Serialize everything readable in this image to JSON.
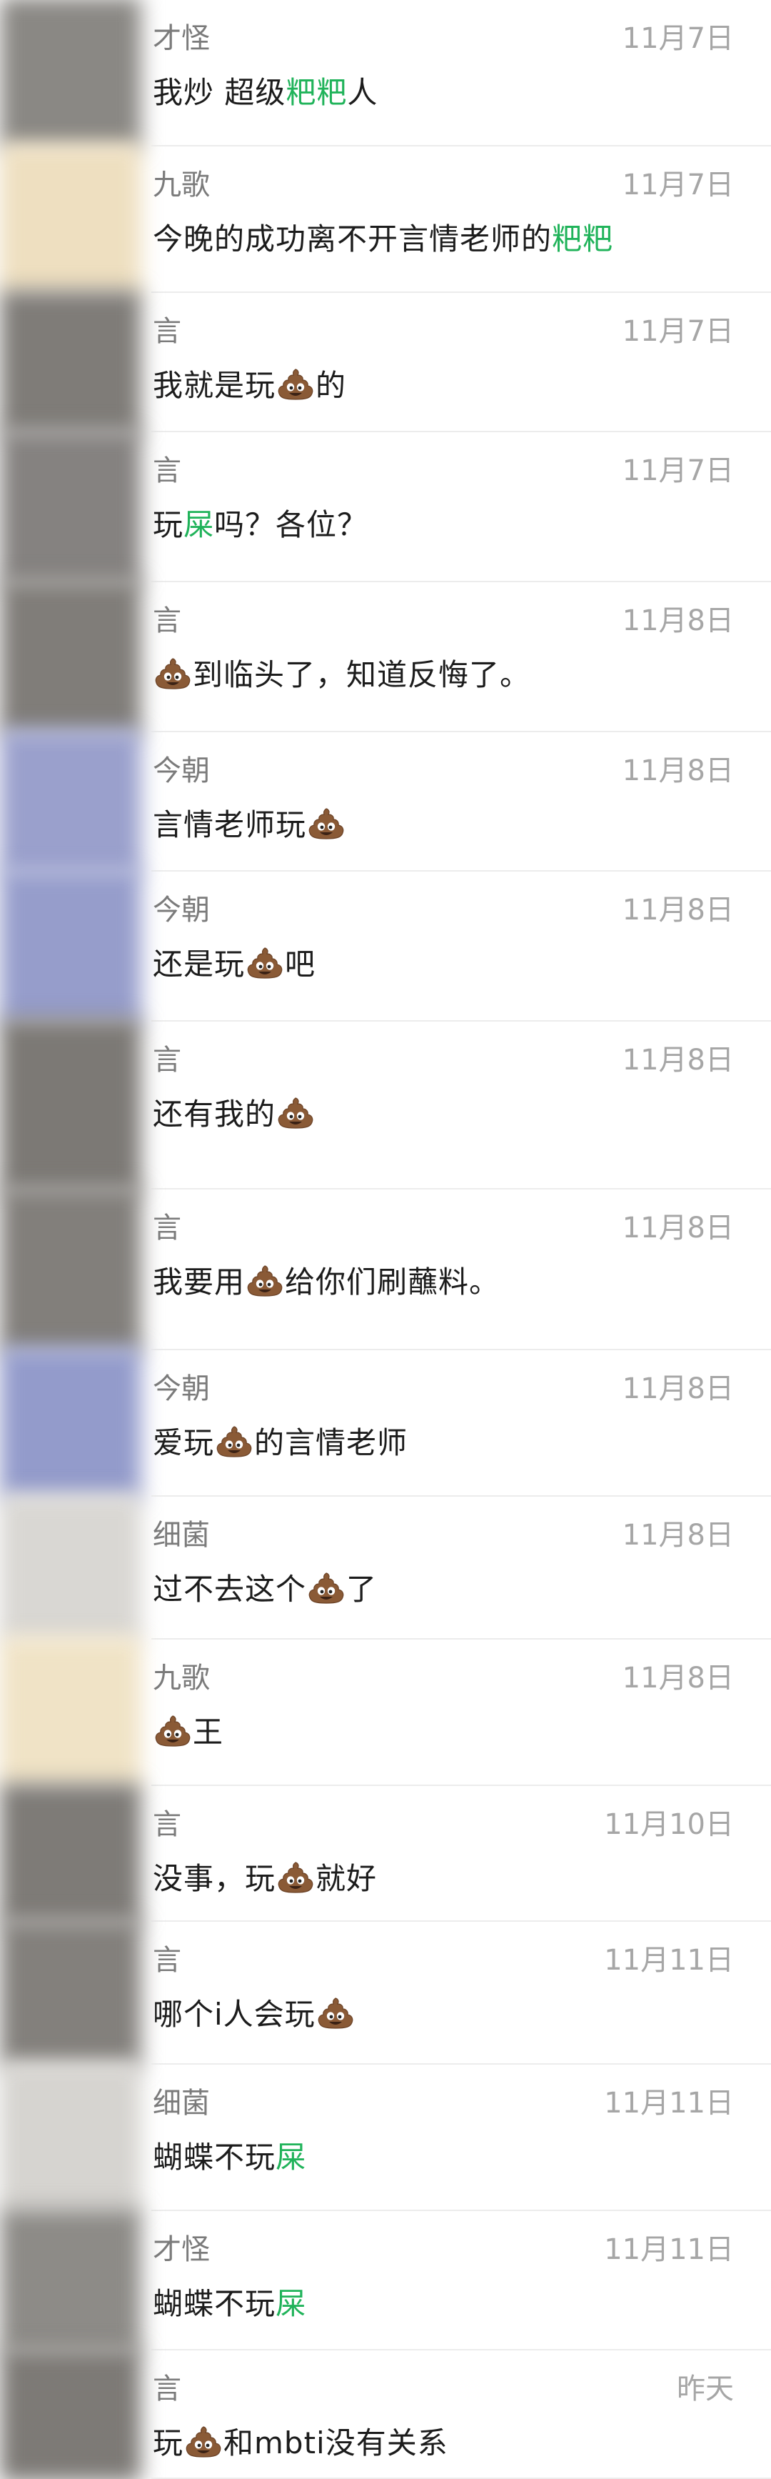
{
  "colors": {
    "highlight": "#20b35a",
    "sender": "#7b7b7b",
    "date": "#a6a6a6",
    "text": "#1c1c1c",
    "avatar_palette": [
      "#8c8a86",
      "#e9d9b6",
      "#9097c6",
      "#d7d5d1",
      "#7f7b77"
    ]
  },
  "messages": [
    {
      "sender": "才怪",
      "date": "11月7日",
      "avatar": "#8a8884",
      "segments": [
        {
          "t": "text",
          "v": "我炒 超级"
        },
        {
          "t": "hl",
          "v": "粑粑"
        },
        {
          "t": "text",
          "v": "人"
        }
      ]
    },
    {
      "sender": "九歌",
      "date": "11月7日",
      "avatar": "#eedfc0",
      "segments": [
        {
          "t": "text",
          "v": "今晚的成功离不开言情老师的"
        },
        {
          "t": "hl",
          "v": "粑粑"
        }
      ]
    },
    {
      "sender": "言",
      "date": "11月7日",
      "avatar": "#7f7c78",
      "segments": [
        {
          "t": "text",
          "v": "我就是玩"
        },
        {
          "t": "icon",
          "v": "poop-emoji"
        },
        {
          "t": "text",
          "v": "的"
        }
      ]
    },
    {
      "sender": "言",
      "date": "11月7日",
      "avatar": "#858280",
      "segments": [
        {
          "t": "text",
          "v": "玩"
        },
        {
          "t": "hl",
          "v": "屎"
        },
        {
          "t": "text",
          "v": "吗？各位？"
        }
      ]
    },
    {
      "sender": "言",
      "date": "11月8日",
      "avatar": "#807d79",
      "segments": [
        {
          "t": "icon",
          "v": "poop-emoji"
        },
        {
          "t": "text",
          "v": "到临头了，知道反悔了。"
        }
      ]
    },
    {
      "sender": "今朝",
      "date": "11月8日",
      "avatar": "#9aa0cc",
      "segments": [
        {
          "t": "text",
          "v": "言情老师玩"
        },
        {
          "t": "icon",
          "v": "poop-emoji"
        }
      ]
    },
    {
      "sender": "今朝",
      "date": "11月8日",
      "avatar": "#969dcb",
      "segments": [
        {
          "t": "text",
          "v": "还是玩"
        },
        {
          "t": "icon",
          "v": "poop-emoji"
        },
        {
          "t": "text",
          "v": "吧"
        }
      ]
    },
    {
      "sender": "言",
      "date": "11月8日",
      "avatar": "#7c7975",
      "segments": [
        {
          "t": "text",
          "v": "还有我的"
        },
        {
          "t": "icon",
          "v": "poop-emoji"
        }
      ]
    },
    {
      "sender": "言",
      "date": "11月8日",
      "avatar": "#827f7b",
      "segments": [
        {
          "t": "text",
          "v": "我要用"
        },
        {
          "t": "icon",
          "v": "poop-emoji"
        },
        {
          "t": "text",
          "v": "给你们刷蘸料。"
        }
      ]
    },
    {
      "sender": "今朝",
      "date": "11月8日",
      "avatar": "#939bcb",
      "segments": [
        {
          "t": "text",
          "v": "爱玩"
        },
        {
          "t": "icon",
          "v": "poop-emoji"
        },
        {
          "t": "text",
          "v": "的言情老师"
        }
      ]
    },
    {
      "sender": "细菌",
      "date": "11月8日",
      "avatar": "#d9d7d3",
      "segments": [
        {
          "t": "text",
          "v": "过不去这个"
        },
        {
          "t": "icon",
          "v": "poop-emoji"
        },
        {
          "t": "text",
          "v": "了"
        }
      ]
    },
    {
      "sender": "九歌",
      "date": "11月8日",
      "avatar": "#f0e3c6",
      "segments": [
        {
          "t": "icon",
          "v": "poop-emoji"
        },
        {
          "t": "text",
          "v": "王"
        }
      ]
    },
    {
      "sender": "言",
      "date": "11月10日",
      "avatar": "#7e7b77",
      "segments": [
        {
          "t": "text",
          "v": "没事，玩"
        },
        {
          "t": "icon",
          "v": "poop-emoji"
        },
        {
          "t": "text",
          "v": "就好"
        }
      ]
    },
    {
      "sender": "言",
      "date": "11月11日",
      "avatar": "#83807c",
      "segments": [
        {
          "t": "text",
          "v": "哪个i人会玩"
        },
        {
          "t": "icon",
          "v": "poop-emoji"
        }
      ]
    },
    {
      "sender": "细菌",
      "date": "11月11日",
      "avatar": "#d6d4d0",
      "segments": [
        {
          "t": "text",
          "v": "蝴蝶不玩"
        },
        {
          "t": "hl",
          "v": "屎"
        }
      ]
    },
    {
      "sender": "才怪",
      "date": "11月11日",
      "avatar": "#8d8b87",
      "segments": [
        {
          "t": "text",
          "v": "蝴蝶不玩"
        },
        {
          "t": "hl",
          "v": "屎"
        }
      ]
    },
    {
      "sender": "言",
      "date": "昨天",
      "avatar": "#7d7a76",
      "segments": [
        {
          "t": "text",
          "v": "玩"
        },
        {
          "t": "icon",
          "v": "poop-emoji"
        },
        {
          "t": "text",
          "v": "和mbti没有关系"
        }
      ]
    }
  ]
}
